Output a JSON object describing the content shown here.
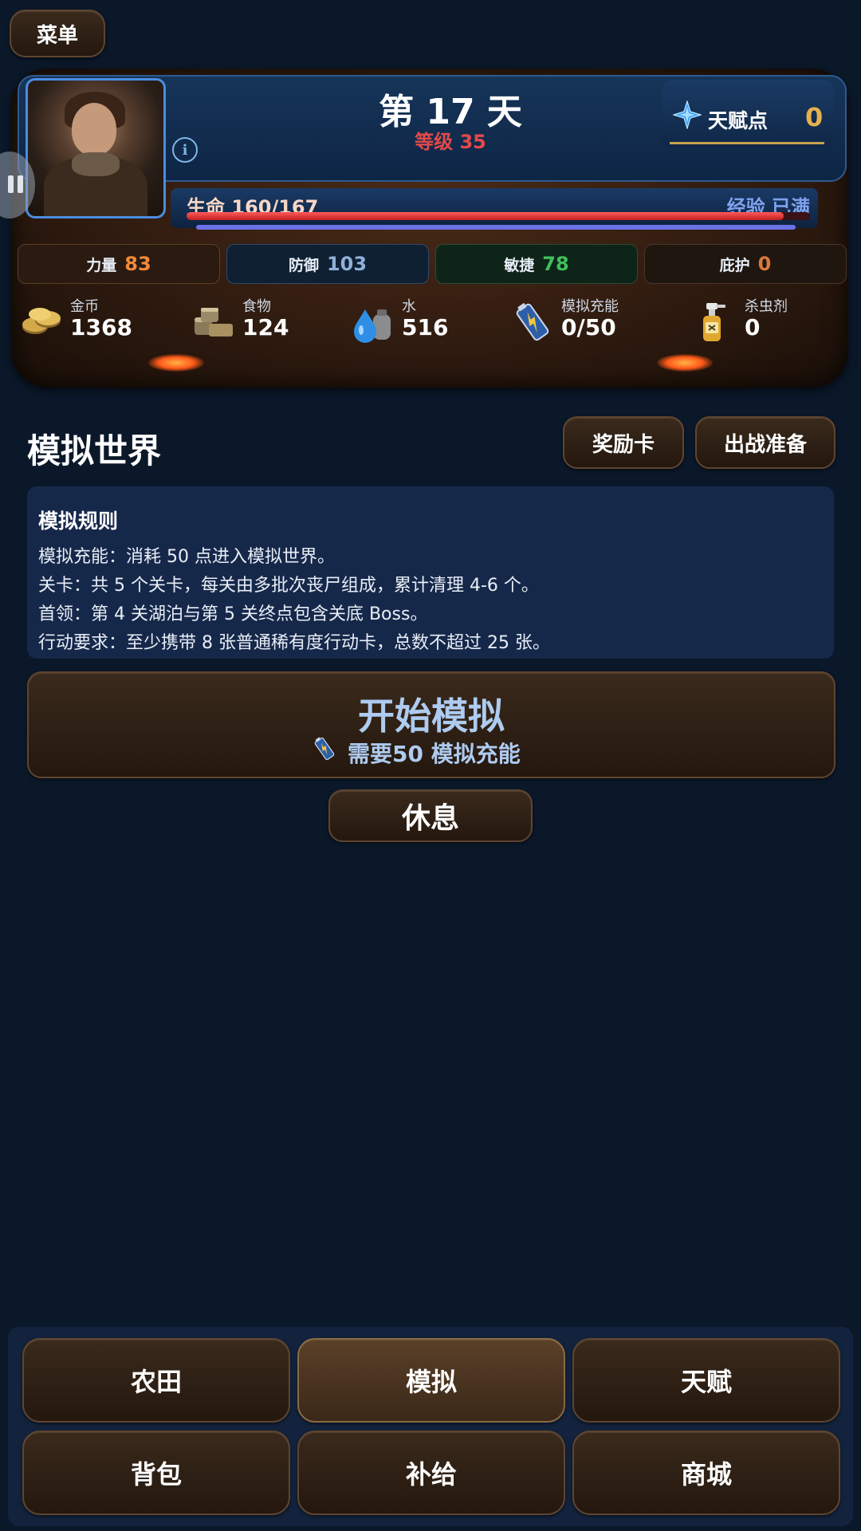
{
  "menu_label": "菜单",
  "header": {
    "day_title": "第 17 天",
    "level_text": "等级 35",
    "talent_label": "天赋点",
    "talent_value": "0"
  },
  "bars": {
    "hp_label": "生命 160/167",
    "hp_current": 160,
    "hp_max": 167,
    "exp_label": "经验 已满",
    "exp_fraction": 1.0
  },
  "stats": [
    {
      "label": "力量",
      "value": "83",
      "color": "#f08a3c"
    },
    {
      "label": "防御",
      "value": "103",
      "color": "#8fb0d8"
    },
    {
      "label": "敏捷",
      "value": "78",
      "color": "#3fbf5a"
    },
    {
      "label": "庇护",
      "value": "0",
      "color": "#d87a3c"
    }
  ],
  "resources": [
    {
      "label": "金币",
      "value": "1368",
      "icon": "coins-icon"
    },
    {
      "label": "食物",
      "value": "124",
      "icon": "food-cans-icon"
    },
    {
      "label": "水",
      "value": "516",
      "icon": "water-drop-icon"
    },
    {
      "label": "模拟充能",
      "value": "0/50",
      "icon": "battery-icon"
    },
    {
      "label": "杀虫剂",
      "value": "0",
      "icon": "spray-bottle-icon"
    }
  ],
  "section": {
    "title": "模拟世界",
    "reward_button": "奖励卡",
    "prepare_button": "出战准备"
  },
  "rules": {
    "title": "模拟规则",
    "lines": [
      "模拟充能：消耗 50 点进入模拟世界。",
      "关卡：共 5 个关卡，每关由多批次丧尸组成，累计清理 4-6 个。",
      "首领：第 4 关湖泊与第 5 关终点包含关底 Boss。",
      "行动要求：至少携带 8 张普通稀有度行动卡，总数不超过 25 张。"
    ]
  },
  "start": {
    "title": "开始模拟",
    "subtitle": "需要50 模拟充能"
  },
  "rest_label": "休息",
  "nav": {
    "active": "模拟",
    "items": [
      "农田",
      "模拟",
      "天赋",
      "背包",
      "补给",
      "商城"
    ]
  }
}
